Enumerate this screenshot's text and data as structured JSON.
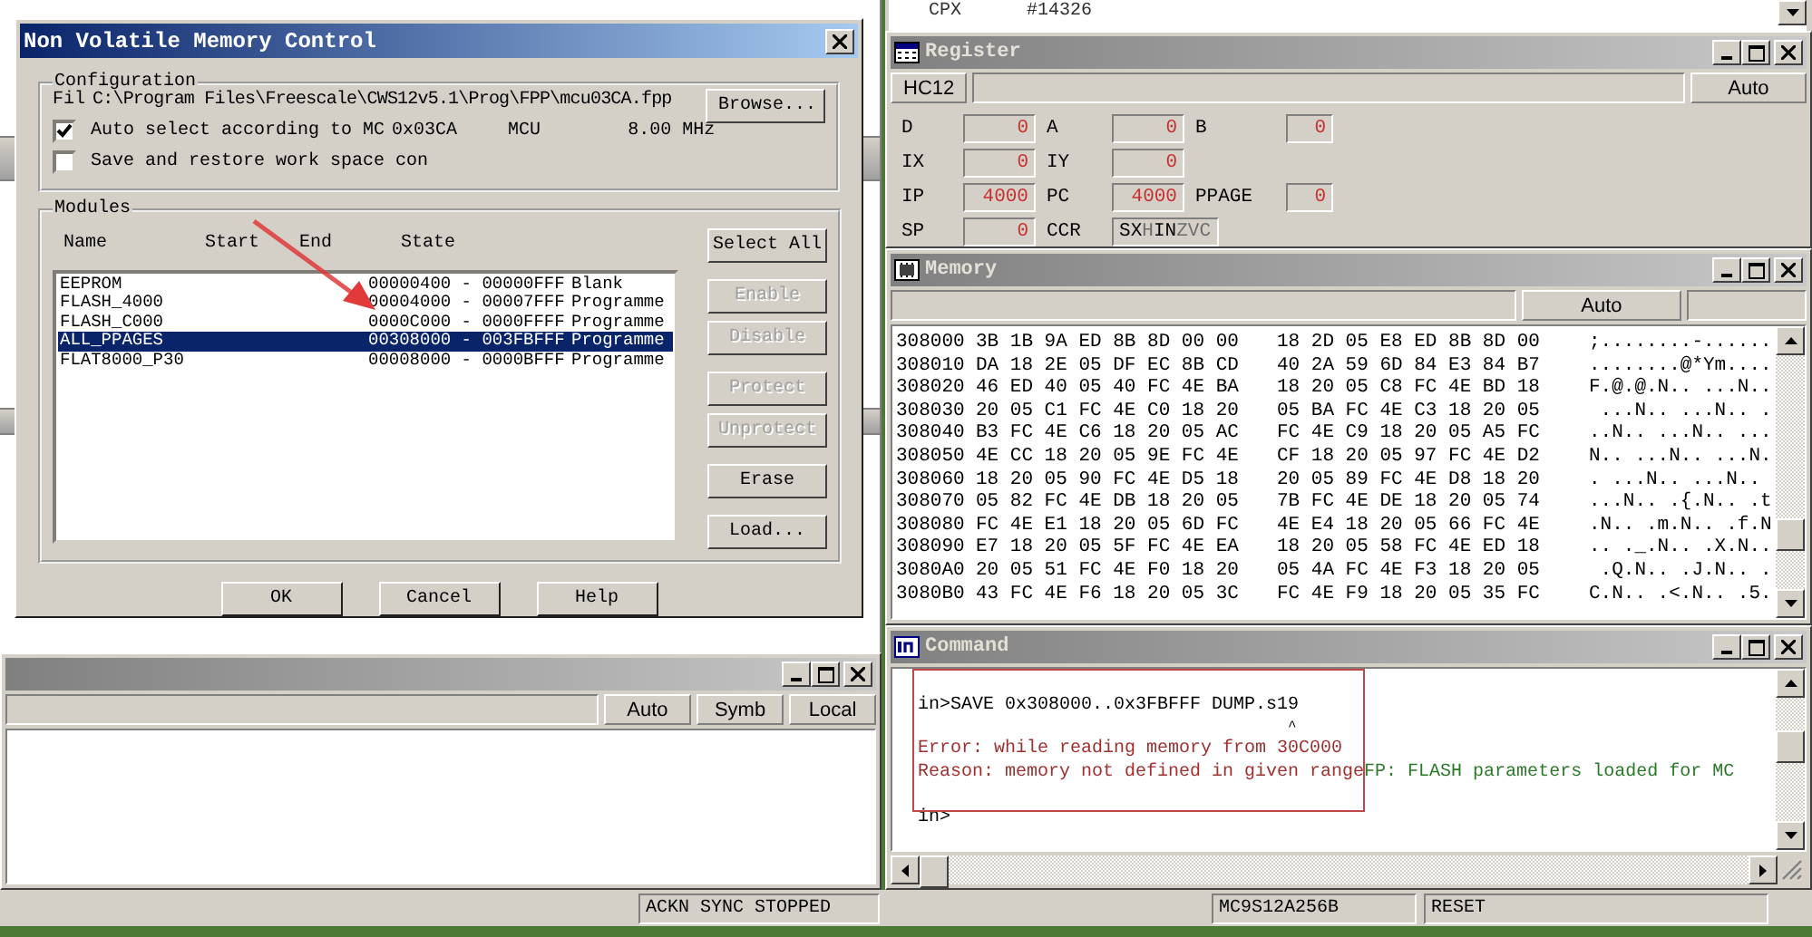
{
  "source_window": {
    "cells": [
      "CPX",
      "#14326"
    ]
  },
  "dialog": {
    "title": "Non Volatile Memory Control",
    "configuration": {
      "label": "Configuration",
      "file_label": "Fil",
      "file_path": "C:\\Program Files\\Freescale\\CWS12v5.1\\Prog\\FPP\\mcu03CA.fpp",
      "browse_button": "Browse...",
      "options": [
        {
          "label": "Auto select according to MC",
          "checked": true
        },
        {
          "label": "Save and restore work space con",
          "checked": false
        }
      ],
      "derivative": "0x03CA",
      "mcu_label": "MCU",
      "frequency": "8.00 MHz"
    },
    "modules": {
      "label": "Modules",
      "columns": [
        "Name",
        "Start",
        "End",
        "State"
      ],
      "rows": [
        {
          "name": "EEPROM",
          "range": "00000400 - 00000FFF",
          "state": "Blank",
          "selected": false
        },
        {
          "name": "FLASH_4000",
          "range": "00004000 - 00007FFF",
          "state": "Programme",
          "selected": false
        },
        {
          "name": "FLASH_C000",
          "range": "0000C000 - 0000FFFF",
          "state": "Programme",
          "selected": false
        },
        {
          "name": "ALL_PPAGES",
          "range": "00308000 - 003FBFFF",
          "state": "Programme",
          "selected": true
        },
        {
          "name": "FLAT8000_P30",
          "range": "00008000 - 0000BFFF",
          "state": "Programme",
          "selected": false
        }
      ],
      "buttons": [
        {
          "label": "Select All",
          "disabled": false
        },
        {
          "label": "Enable",
          "disabled": true
        },
        {
          "label": "Disable",
          "disabled": true
        },
        {
          "label": "Protect",
          "disabled": true
        },
        {
          "label": "Unprotect",
          "disabled": true
        },
        {
          "label": "Erase",
          "disabled": false
        },
        {
          "label": "Load...",
          "disabled": false
        }
      ]
    },
    "buttons": [
      "OK",
      "Cancel",
      "Help"
    ]
  },
  "register": {
    "title": "Register",
    "cpu": "HC12",
    "mode": "Auto",
    "rows": [
      {
        "cells": [
          {
            "kind": "value",
            "name": "D",
            "value": "0"
          },
          {
            "kind": "value",
            "name": "A",
            "value": "0"
          },
          {
            "kind": "value",
            "name": "B",
            "value": "0"
          }
        ]
      },
      {
        "cells": [
          {
            "kind": "value",
            "name": "IX",
            "value": "0"
          },
          {
            "kind": "value",
            "name": "IY",
            "value": "0"
          }
        ]
      },
      {
        "cells": [
          {
            "kind": "value",
            "name": "IP",
            "value": "4000"
          },
          {
            "kind": "value",
            "name": "PC",
            "value": "4000"
          },
          {
            "kind": "value",
            "name": "PPAGE",
            "value": "0"
          }
        ]
      },
      {
        "cells": [
          {
            "kind": "value",
            "name": "SP",
            "value": "0"
          },
          {
            "kind": "flags",
            "name": "CCR",
            "flags": [
              {
                "letter": "S",
                "set": true
              },
              {
                "letter": "X",
                "set": true
              },
              {
                "letter": "H",
                "set": false
              },
              {
                "letter": "I",
                "set": true
              },
              {
                "letter": "N",
                "set": true
              },
              {
                "letter": "Z",
                "set": false
              },
              {
                "letter": "V",
                "set": false
              },
              {
                "letter": "C",
                "set": false
              }
            ]
          }
        ]
      }
    ]
  },
  "memory": {
    "title": "Memory",
    "mode": "Auto",
    "rows": [
      {
        "address": "308000",
        "hex_1": "3B 1B 9A ED 8B 8D 00 00",
        "hex_2": "18 2D 05 E8 ED 8B 8D 00",
        "ascii": ";........-......"
      },
      {
        "address": "308010",
        "hex_1": "DA 18 2E 05 DF EC 8B CD",
        "hex_2": "40 2A 59 6D 84 E3 84 B7",
        "ascii": "........@*Ym...."
      },
      {
        "address": "308020",
        "hex_1": "46 ED 40 05 40 FC 4E BA",
        "hex_2": "18 20 05 C8 FC 4E BD 18",
        "ascii": "F.@.@.N.. ...N.."
      },
      {
        "address": "308030",
        "hex_1": "20 05 C1 FC 4E C0 18 20",
        "hex_2": "05 BA FC 4E C3 18 20 05",
        "ascii": " ...N.. ...N.. ."
      },
      {
        "address": "308040",
        "hex_1": "B3 FC 4E C6 18 20 05 AC",
        "hex_2": "FC 4E C9 18 20 05 A5 FC",
        "ascii": "..N.. ...N.. ..."
      },
      {
        "address": "308050",
        "hex_1": "4E CC 18 20 05 9E FC 4E",
        "hex_2": "CF 18 20 05 97 FC 4E D2",
        "ascii": "N.. ...N.. ...N."
      },
      {
        "address": "308060",
        "hex_1": "18 20 05 90 FC 4E D5 18",
        "hex_2": "20 05 89 FC 4E D8 18 20",
        "ascii": ". ...N.. ...N.."
      },
      {
        "address": "308070",
        "hex_1": "05 82 FC 4E DB 18 20 05",
        "hex_2": "7B FC 4E DE 18 20 05 74",
        "ascii": "...N.. .{.N.. .t"
      },
      {
        "address": "308080",
        "hex_1": "FC 4E E1 18 20 05 6D FC",
        "hex_2": "4E E4 18 20 05 66 FC 4E",
        "ascii": ".N.. .m.N.. .f.N"
      },
      {
        "address": "308090",
        "hex_1": "E7 18 20 05 5F FC 4E EA",
        "hex_2": "18 20 05 58 FC 4E ED 18",
        "ascii": ".. ._.N.. .X.N.."
      },
      {
        "address": "3080A0",
        "hex_1": "20 05 51 FC 4E F0 18 20",
        "hex_2": "05 4A FC 4E F3 18 20 05",
        "ascii": " .Q.N.. .J.N.. ."
      },
      {
        "address": "3080B0",
        "hex_1": "43 FC 4E F6 18 20 05 3C",
        "hex_2": "FC 4E F9 18 20 05 35 FC",
        "ascii": "C.N.. .<.N.. .5."
      }
    ]
  },
  "command": {
    "title": "Command",
    "lines": [
      {
        "segments": [
          {
            "kind": "input",
            "text": "in>SAVE 0x308000..0x3FBFFF DUMP.s19"
          }
        ]
      },
      {
        "segments": [
          {
            "kind": "caret",
            "text": "^"
          }
        ]
      },
      {
        "segments": [
          {
            "kind": "error",
            "text": "Error: while reading memory from 30C000"
          }
        ]
      },
      {
        "segments": [
          {
            "kind": "error",
            "text": "Reason: memory not defined in given range"
          },
          {
            "kind": "info",
            "text": "FP: FLASH parameters loaded for MC"
          }
        ]
      },
      {
        "segments": [
          {
            "kind": "prompt",
            "text": "in>"
          }
        ]
      }
    ]
  },
  "data_window": {
    "buttons": [
      "Auto",
      "Symb",
      "Local"
    ]
  },
  "status_bar": [
    "ACKN SYNC STOPPED",
    "MC9S12A256B",
    "RESET"
  ]
}
